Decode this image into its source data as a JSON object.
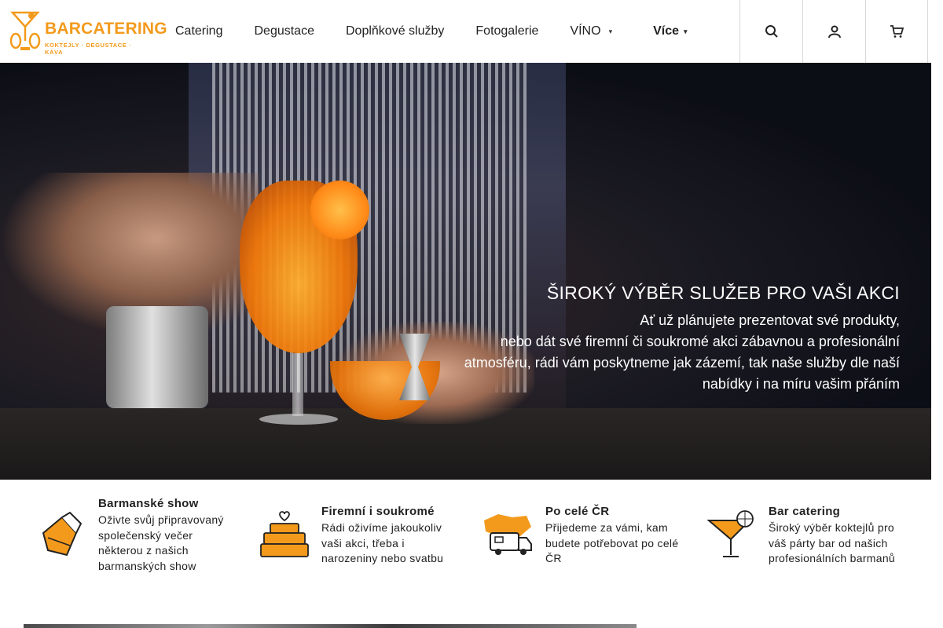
{
  "brand": {
    "name": "BARCATERING",
    "tagline": "KOKTEJLY · DEGUSTACE · KÁVA",
    "accent": "#f39a1c"
  },
  "nav": {
    "items": [
      {
        "label": "Catering"
      },
      {
        "label": "Degustace"
      },
      {
        "label": "Doplňkové služby"
      },
      {
        "label": "Fotogalerie"
      },
      {
        "label": "VÍNO",
        "caret": "chevron-down-icon"
      }
    ],
    "more": {
      "label": "Více",
      "caret": "chevron-down-icon"
    },
    "icons": [
      "search-icon",
      "user-icon",
      "cart-icon"
    ]
  },
  "hero": {
    "title": "ŠIROKÝ VÝBĚR SLUŽEB PRO VAŠI AKCI",
    "lines": [
      "Ať už plánujete prezentovat své produkty,",
      "nebo dát své firemní či soukromé akci zábavnou a profesionální",
      "atmosféru, rádi vám poskytneme jak zázemí, tak naše služby dle naší",
      "nabídky i na míru vašim přáním"
    ]
  },
  "features": [
    {
      "icon": "cocktail-shaker-icon",
      "title": "Barmanské show",
      "desc": "Oživte svůj připravovaný společenský večer některou z našich barmanských show"
    },
    {
      "icon": "cake-icon",
      "title": "Firemní i soukromé",
      "desc": "Rádi oživíme jakoukoliv vaši akci, třeba i narozeniny nebo svatbu"
    },
    {
      "icon": "truck-map-icon",
      "title": "Po celé ČR",
      "desc": "Přijedeme za vámi, kam budete potřebovat po celé ČR"
    },
    {
      "icon": "martini-glass-icon",
      "title": "Bar catering",
      "desc": "Široký výběr koktejlů pro váš párty bar od našich profesionálních barmanů"
    }
  ]
}
